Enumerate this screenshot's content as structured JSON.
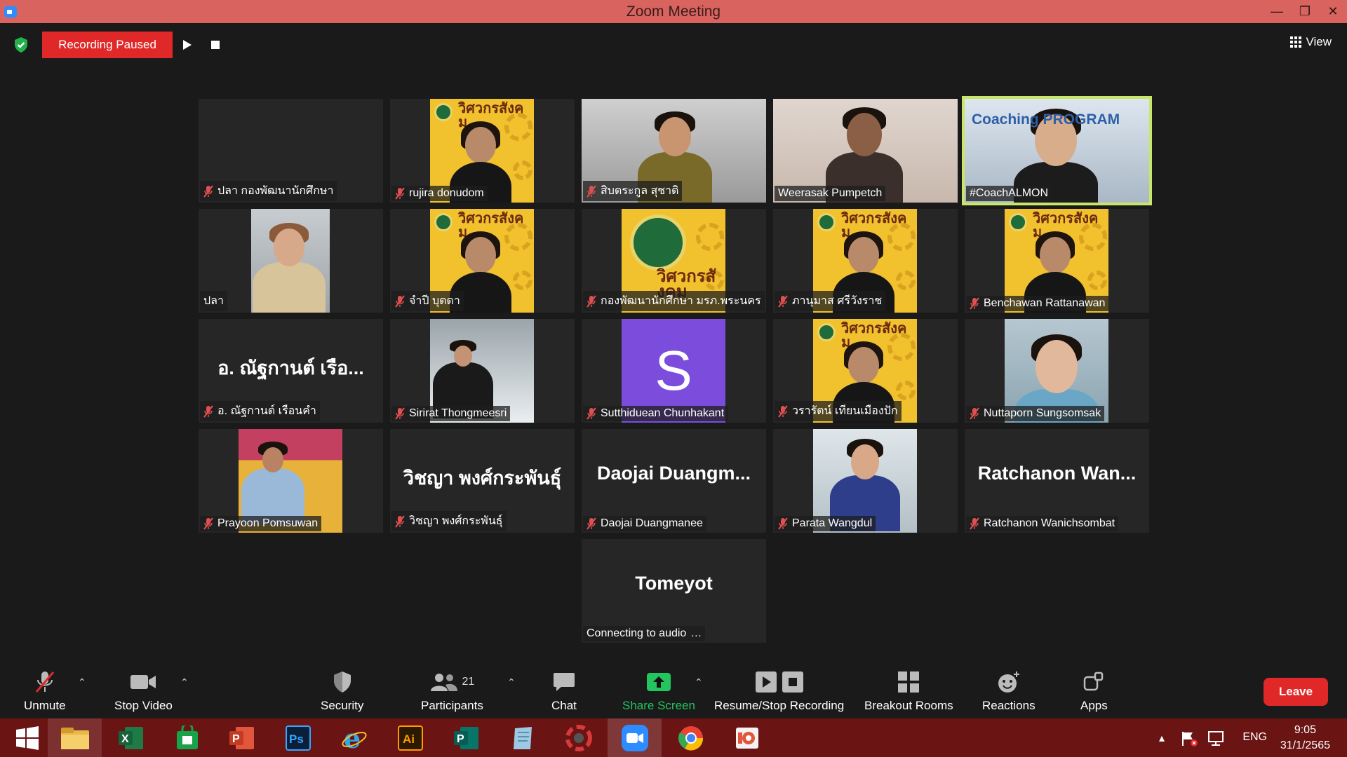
{
  "window": {
    "title": "Zoom Meeting",
    "controls": [
      "minimize",
      "restore",
      "close"
    ]
  },
  "recording": {
    "status": "Recording Paused",
    "resume_icon": "play-icon",
    "stop_icon": "stop-icon"
  },
  "view_button": {
    "label": "View",
    "icon": "grid-icon"
  },
  "gallery": {
    "tiles": [
      {
        "name": "ปลา กองพัฒนานักศึกษา",
        "muted": true,
        "kind": "blank"
      },
      {
        "name": "rujira donudom",
        "muted": true,
        "kind": "yellow-person"
      },
      {
        "name": "สิบตระกูล สุชาติ",
        "muted": true,
        "kind": "photo-office"
      },
      {
        "name": "Weerasak Pumpetch",
        "muted": false,
        "kind": "photo-man"
      },
      {
        "name": "#CoachALMON",
        "muted": false,
        "kind": "coach",
        "active": true,
        "banner": "Coaching PROGRAM"
      },
      {
        "name": "ปลา",
        "muted": false,
        "kind": "photo-woman"
      },
      {
        "name": "จำปี บุตดา",
        "muted": true,
        "kind": "yellow-person"
      },
      {
        "name": "กองพัฒนานักศึกษา มรภ.พระนคร",
        "muted": true,
        "kind": "yellow-logo"
      },
      {
        "name": "ภานุมาส ศรีวังราช",
        "muted": true,
        "kind": "yellow-person"
      },
      {
        "name": "Benchawan Rattanawan",
        "muted": true,
        "kind": "yellow-person"
      },
      {
        "name": "อ. ณัฐกานต์ เรือนคำ",
        "muted": true,
        "kind": "text",
        "display": "อ. ณัฐกานต์  เรือ..."
      },
      {
        "name": "Sirirat Thongmeesri",
        "muted": true,
        "kind": "photo-snow"
      },
      {
        "name": "Sutthiduean Chunhakant",
        "muted": true,
        "kind": "avatar",
        "initial": "S"
      },
      {
        "name": "วรารัตน์ เทียนเมืองปัก",
        "muted": true,
        "kind": "yellow-person"
      },
      {
        "name": "Nuttaporn Sungsomsak",
        "muted": true,
        "kind": "photo-selfie"
      },
      {
        "name": "Prayoon Pomsuwan",
        "muted": true,
        "kind": "photo-speech"
      },
      {
        "name": "วิชญา พงศ์กระพันธุ์",
        "muted": true,
        "kind": "text",
        "display": "วิชญา  พงศ์กระพันธุ์"
      },
      {
        "name": "Daojai Duangmanee",
        "muted": true,
        "kind": "text",
        "display": "Daojai  Duangm..."
      },
      {
        "name": "Parata Wangdul",
        "muted": true,
        "kind": "photo-office-woman"
      },
      {
        "name": "Ratchanon Wanichsombat",
        "muted": true,
        "kind": "text",
        "display": "Ratchanon  Wan..."
      },
      {
        "name": "Connecting to audio",
        "muted": false,
        "kind": "text",
        "display": "Tomeyot",
        "connecting": true
      }
    ],
    "banner_text": "วิศวกรสังคม"
  },
  "toolbar": {
    "unmute": "Unmute",
    "stop_video": "Stop Video",
    "security": "Security",
    "participants": "Participants",
    "participants_count": "21",
    "chat": "Chat",
    "share_screen": "Share Screen",
    "resume_stop_recording": "Resume/Stop Recording",
    "breakout_rooms": "Breakout Rooms",
    "reactions": "Reactions",
    "apps": "Apps",
    "leave": "Leave"
  },
  "taskbar": {
    "apps": [
      "windows-start",
      "file-explorer",
      "excel",
      "publisher-green",
      "powerpoint",
      "photoshop",
      "internet-explorer",
      "illustrator",
      "publisher",
      "notepad",
      "photoscape",
      "zoom",
      "chrome",
      "office-lens"
    ],
    "language": "ENG",
    "time": "9:05",
    "date": "31/1/2565"
  },
  "colors": {
    "title_bar": "#d9645f",
    "recording_red": "#e02828",
    "active_speaker": "#c7e66a",
    "share_green": "#22c55e",
    "taskbar": "#6a1414"
  }
}
